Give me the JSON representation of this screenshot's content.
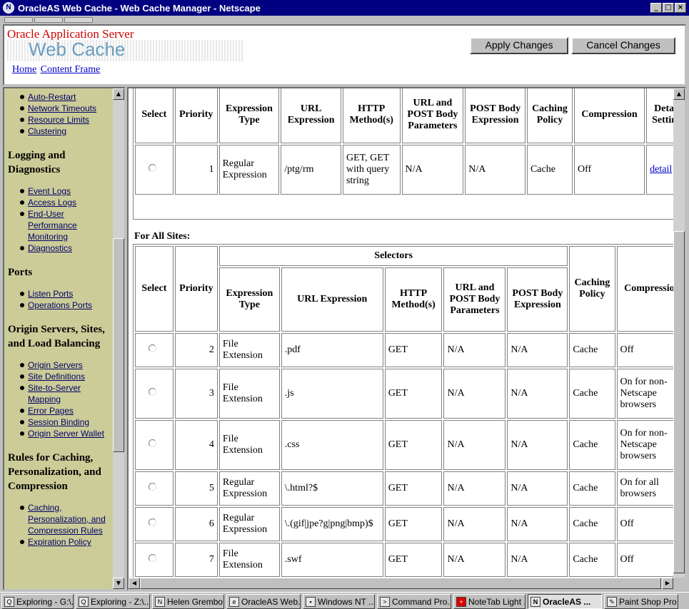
{
  "window": {
    "title": "OracleAS Web Cache - Web Cache Manager - Netscape",
    "icon": "netscape-icon"
  },
  "header": {
    "brand_top": "Oracle Application Server",
    "brand_product": "Web Cache",
    "links": [
      "Home",
      "Content Frame"
    ],
    "apply_label": "Apply Changes",
    "cancel_label": "Cancel Changes"
  },
  "nav": {
    "top_items": [
      "Auto-Restart",
      "Network Timeouts",
      "Resource Limits",
      "Clustering"
    ],
    "sections": [
      {
        "heading": "Logging and Diagnostics",
        "items": [
          "Event Logs",
          "Access Logs",
          "End-User Performance Monitoring",
          "Diagnostics"
        ]
      },
      {
        "heading": "Ports",
        "items": [
          "Listen Ports",
          "Operations Ports"
        ]
      },
      {
        "heading": "Origin Servers, Sites, and Load Balancing",
        "items": [
          "Origin Servers",
          "Site Definitions",
          "Site-to-Server Mapping",
          "Error Pages",
          "Session Binding",
          "Origin Server Wallet"
        ]
      },
      {
        "heading": "Rules for Caching, Personalization, and Compression",
        "items": [
          "Caching, Personalization, and Compression Rules",
          "Expiration Policy"
        ]
      }
    ]
  },
  "site_table": {
    "headers": [
      "Select",
      "Priority",
      "Expression Type",
      "URL Expression",
      "HTTP Method(s)",
      "URL and POST Body Parameters",
      "POST Body Expression",
      "Caching Policy",
      "Compression",
      "Detail Setting"
    ],
    "rows": [
      {
        "priority": "1",
        "expr_type": "Regular Expression",
        "url": "/ptg/rm",
        "method": "GET, GET with query string",
        "params": "N/A",
        "post_expr": "N/A",
        "policy": "Cache",
        "compression": "Off",
        "detail": "detail"
      }
    ]
  },
  "all_sites": {
    "label": "For All Sites:",
    "selectors_header": "Selectors",
    "headers": [
      "Select",
      "Priority",
      "Expression Type",
      "URL Expression",
      "HTTP Method(s)",
      "URL and POST Body Parameters",
      "POST Body Expression",
      "Caching Policy",
      "Compression"
    ],
    "rows": [
      {
        "priority": "2",
        "expr_type": "File Extension",
        "url": ".pdf",
        "method": "GET",
        "params": "N/A",
        "post_expr": "N/A",
        "policy": "Cache",
        "compression": "Off"
      },
      {
        "priority": "3",
        "expr_type": "File Extension",
        "url": ".js",
        "method": "GET",
        "params": "N/A",
        "post_expr": "N/A",
        "policy": "Cache",
        "compression": "On for non-Netscape browsers"
      },
      {
        "priority": "4",
        "expr_type": "File Extension",
        "url": ".css",
        "method": "GET",
        "params": "N/A",
        "post_expr": "N/A",
        "policy": "Cache",
        "compression": "On for non-Netscape browsers"
      },
      {
        "priority": "5",
        "expr_type": "Regular Expression",
        "url": "\\.html?$",
        "method": "GET",
        "params": "N/A",
        "post_expr": "N/A",
        "policy": "Cache",
        "compression": "On for all browsers"
      },
      {
        "priority": "6",
        "expr_type": "Regular Expression",
        "url": "\\.(gif|jpe?g|png|bmp)$",
        "method": "GET",
        "params": "N/A",
        "post_expr": "N/A",
        "policy": "Cache",
        "compression": "Off"
      },
      {
        "priority": "7",
        "expr_type": "File Extension",
        "url": ".swf",
        "method": "GET",
        "params": "N/A",
        "post_expr": "N/A",
        "policy": "Cache",
        "compression": "Off"
      }
    ]
  },
  "taskbar": [
    {
      "label": "Exploring - G:\\...",
      "icon": "explorer-icon",
      "active": false
    },
    {
      "label": "Exploring - Z:\\...",
      "icon": "explorer-icon",
      "active": false
    },
    {
      "label": "Helen Grembo...",
      "icon": "netscape-icon",
      "active": false
    },
    {
      "label": "OracleAS Web...",
      "icon": "document-icon",
      "active": false
    },
    {
      "label": "Windows NT ...",
      "icon": "computer-icon",
      "active": false
    },
    {
      "label": "Command Pro...",
      "icon": "terminal-icon",
      "active": false
    },
    {
      "label": "NoteTab Light ...",
      "icon": "notetab-icon",
      "active": false
    },
    {
      "label": "OracleAS ...",
      "icon": "netscape-icon",
      "active": true
    },
    {
      "label": "Paint Shop Pro...",
      "icon": "paint-icon",
      "active": false
    }
  ]
}
